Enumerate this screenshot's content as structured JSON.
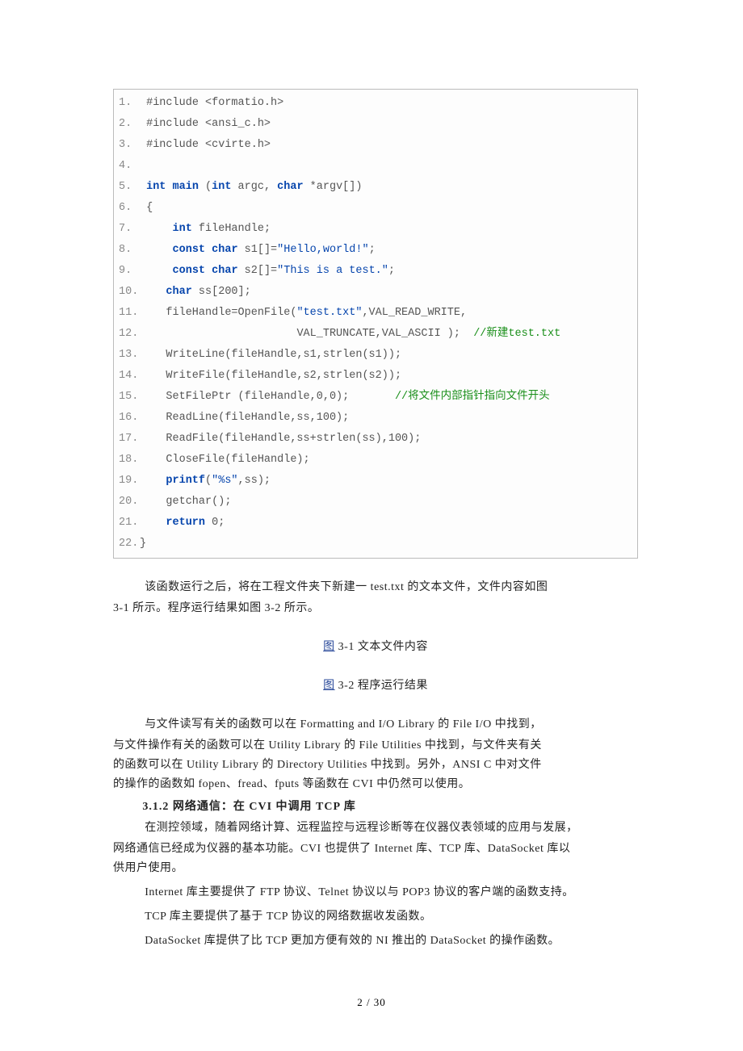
{
  "code": {
    "lines": [
      {
        "n": "1.",
        "pre": " ",
        "tokens": [
          {
            "t": "#include <formatio.h>"
          }
        ]
      },
      {
        "n": "2.",
        "pre": " ",
        "tokens": [
          {
            "t": "#include <ansi_c.h>"
          }
        ]
      },
      {
        "n": "3.",
        "pre": " ",
        "tokens": [
          {
            "t": "#include <cvirte.h>"
          }
        ]
      },
      {
        "n": "4.",
        "pre": "",
        "tokens": []
      },
      {
        "n": "5.",
        "pre": " ",
        "tokens": [
          {
            "t": "int",
            "c": "kw"
          },
          {
            "t": " "
          },
          {
            "t": "main",
            "c": "kw"
          },
          {
            "t": " ("
          },
          {
            "t": "int",
            "c": "kw"
          },
          {
            "t": " argc, "
          },
          {
            "t": "char",
            "c": "kw"
          },
          {
            "t": " *argv[])"
          }
        ]
      },
      {
        "n": "6.",
        "pre": " ",
        "tokens": [
          {
            "t": "{"
          }
        ]
      },
      {
        "n": "7.",
        "pre": "     ",
        "tokens": [
          {
            "t": "int",
            "c": "kw"
          },
          {
            "t": " fileHandle;"
          }
        ]
      },
      {
        "n": "8.",
        "pre": "     ",
        "tokens": [
          {
            "t": "const",
            "c": "kw"
          },
          {
            "t": " "
          },
          {
            "t": "char",
            "c": "kw"
          },
          {
            "t": " s1[]="
          },
          {
            "t": "\"Hello,world!\"",
            "c": "str"
          },
          {
            "t": ";"
          }
        ]
      },
      {
        "n": "9.",
        "pre": "     ",
        "tokens": [
          {
            "t": "const",
            "c": "kw"
          },
          {
            "t": " "
          },
          {
            "t": "char",
            "c": "kw"
          },
          {
            "t": " s2[]="
          },
          {
            "t": "\"This is a test.\"",
            "c": "str"
          },
          {
            "t": ";"
          }
        ]
      },
      {
        "n": "10.",
        "pre": "    ",
        "tokens": [
          {
            "t": "char",
            "c": "kw"
          },
          {
            "t": " ss[200];"
          }
        ]
      },
      {
        "n": "11.",
        "pre": "    ",
        "tokens": [
          {
            "t": "fileHandle=OpenFile("
          },
          {
            "t": "\"test.txt\"",
            "c": "str"
          },
          {
            "t": ",VAL_READ_WRITE,"
          }
        ]
      },
      {
        "n": "12.",
        "pre": "                        ",
        "tokens": [
          {
            "t": "VAL_TRUNCATE,VAL_ASCII );  "
          },
          {
            "t": "//新建test.txt",
            "c": "cmt"
          }
        ]
      },
      {
        "n": "13.",
        "pre": "    ",
        "tokens": [
          {
            "t": "WriteLine(fileHandle,s1,strlen(s1));"
          }
        ]
      },
      {
        "n": "14.",
        "pre": "    ",
        "tokens": [
          {
            "t": "WriteFile(fileHandle,s2,strlen(s2));"
          }
        ]
      },
      {
        "n": "15.",
        "pre": "    ",
        "tokens": [
          {
            "t": "SetFilePtr (fileHandle,0,0);       "
          },
          {
            "t": "//将文件内部指针指向文件开头",
            "c": "cmt"
          }
        ]
      },
      {
        "n": "16.",
        "pre": "    ",
        "tokens": [
          {
            "t": "ReadLine(fileHandle,ss,100);"
          }
        ]
      },
      {
        "n": "17.",
        "pre": "    ",
        "tokens": [
          {
            "t": "ReadFile(fileHandle,ss+strlen(ss),100);"
          }
        ]
      },
      {
        "n": "18.",
        "pre": "    ",
        "tokens": [
          {
            "t": "CloseFile(fileHandle);"
          }
        ]
      },
      {
        "n": "19.",
        "pre": "    ",
        "tokens": [
          {
            "t": "printf",
            "c": "kw"
          },
          {
            "t": "("
          },
          {
            "t": "\"%s\"",
            "c": "str"
          },
          {
            "t": ",ss);"
          }
        ]
      },
      {
        "n": "20.",
        "pre": "    ",
        "tokens": [
          {
            "t": "getchar();"
          }
        ]
      },
      {
        "n": "21.",
        "pre": "    ",
        "tokens": [
          {
            "t": "return",
            "c": "kw"
          },
          {
            "t": " 0;"
          }
        ]
      },
      {
        "n": "22.",
        "pre": "",
        "tokens": [
          {
            "t": "}"
          }
        ]
      }
    ]
  },
  "body": {
    "p1": "该函数运行之后，将在工程文件夹下新建一 test.txt 的文本文件，文件内容如图",
    "p1b": "3-1 所示。程序运行结果如图 3-2 所示。",
    "cap1_u": "图",
    "cap1_t": " 3-1 文本文件内容",
    "cap2_u": "图",
    "cap2_t": " 3-2 程序运行结果",
    "p2": "与文件读写有关的函数可以在 Formatting and I/O Library 的 File I/O 中找到，",
    "p2l2": "与文件操作有关的函数可以在 Utility Library 的 File Utilities 中找到，与文件夹有关",
    "p2l3": "的函数可以在 Utility Library 的 Directory Utilities 中找到。另外，ANSI C 中对文件",
    "p2l4": "的操作的函数如 fopen、fread、fputs 等函数在 CVI 中仍然可以使用。",
    "sect": "3.1.2  网络通信：在 CVI 中调用 TCP 库",
    "p3": "在测控领域，随着网络计算、远程监控与远程诊断等在仪器仪表领域的应用与发展，",
    "p3l2": "网络通信已经成为仪器的基本功能。CVI 也提供了 Internet 库、TCP 库、DataSocket 库以",
    "p3l3": "供用户使用。",
    "p4": "Internet 库主要提供了 FTP 协议、Telnet 协议以与 POP3 协议的客户端的函数支持。",
    "p5": "TCP 库主要提供了基于 TCP 协议的网络数据收发函数。",
    "p6": "DataSocket 库提供了比 TCP 更加方便有效的 NI 推出的 DataSocket 的操作函数。"
  },
  "footer": "2 / 30"
}
